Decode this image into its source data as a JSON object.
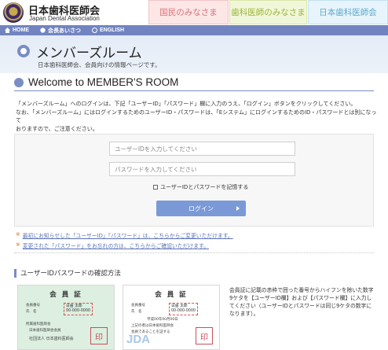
{
  "header": {
    "logo_jp": "日本歯科医師会",
    "logo_en": "Japan Dental Association",
    "tabs": [
      "国民のみなさま",
      "歯科医師のみなさま",
      "日本歯科医師会"
    ]
  },
  "nav": {
    "items": [
      "HOME",
      "会長あいさつ",
      "ENGLISH"
    ]
  },
  "title": {
    "main": "メンバーズルーム",
    "sub": "日本歯科医師会、会員向けの情報ページです。"
  },
  "welcome": "Welcome to MEMBER'S ROOM",
  "intro": {
    "line1": "「メンバーズルーム」へのログインは、下記「ユーザーID」「パスワード」欄に入力のうえ、「ログイン」ボタンをクリックしてください。",
    "line2": "なお、「メンバーズルーム」にはログインするためのユーザーID・パスワードは、「Eシステム」にログインするためのID・パスワードとは別になって",
    "line3": "おりますので、ご注意ください。"
  },
  "login": {
    "user_placeholder": "ユーザーIDを入力してください",
    "pass_placeholder": "パスワードを入力してください",
    "remember_label": "ユーザーIDとパスワードを記憶する",
    "button_label": "ログイン"
  },
  "notes": [
    {
      "mark": "※",
      "text": "最初にお知らせした「ユーザーID」「パスワード」は、こちらからご変更いただけます。"
    },
    {
      "mark": "※",
      "text": "変更された「パスワード」をお忘れの方は、こちらからご確認いただけます。"
    }
  ],
  "section": {
    "heading": "ユーザーIDパスワードの確認方法",
    "description": "会員証に記載の赤枠で囲った番号からハイフンを除いた数字9ケタを【ユーザーID欄】および【パスワード欄】に入力してください（ユーザーIDとパスワードは同じ9ケタの数字になります）。"
  },
  "cards": [
    {
      "title": "会 員 証",
      "label1": "会員番号",
      "label2": "氏　名",
      "id_text": "00-000-0000",
      "name_text": "日歯 太郎",
      "line_a": "所属歯科医師会",
      "line_b": "日本歯科医師会会員",
      "line_c": "社団法人 日本歯科医師会",
      "seal": "印"
    },
    {
      "title": "会 員 証",
      "label1": "会員番号",
      "label2": "氏　名",
      "id_text": "00-000-0000",
      "name_text": "日歯 太郎",
      "line_a": "平成00年00月00日",
      "line_b": "上記の者は日本歯科医師会",
      "line_c": "会員であることを証する",
      "jda": "JDA",
      "seal": "印"
    }
  ]
}
